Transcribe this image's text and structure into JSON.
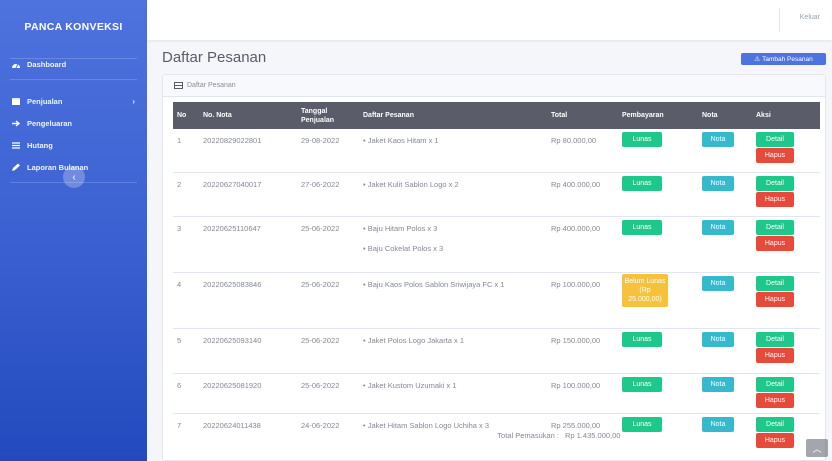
{
  "brand": "PANCA KONVEKSI",
  "sidebar": {
    "items": [
      {
        "label": "Dashboard",
        "icon": "dashboard-icon"
      },
      {
        "label": "Penjualan",
        "icon": "cart-icon"
      },
      {
        "label": "Pengeluaran",
        "icon": "arrow-right-icon"
      },
      {
        "label": "Hutang",
        "icon": "list-icon"
      },
      {
        "label": "Laporan Bulanan",
        "icon": "pencil-icon"
      }
    ]
  },
  "topbar": {
    "logout": "Keluar"
  },
  "page": {
    "title": "Daftar Pesanan",
    "add_button": "Tambah Pesanan",
    "card_title": "Daftar Pesanan"
  },
  "table": {
    "headers": [
      "No",
      "No. Nota",
      "Tanggal Penjualan",
      "Daftar Pesanan",
      "Total",
      "Pembayaran",
      "Nota",
      "Aksi"
    ],
    "rows": [
      {
        "no": "1",
        "nota": "20220829022801",
        "tanggal": "29-08-2022",
        "items": [
          "Jaket Kaos Hitam x 1"
        ],
        "total": "Rp 80.000,00",
        "bayar": "Lunas",
        "status": "lunas"
      },
      {
        "no": "2",
        "nota": "20220627040017",
        "tanggal": "27-06-2022",
        "items": [
          "Jaket Kulit Sablon Logo x 2"
        ],
        "total": "Rp 400.000,00",
        "bayar": "Lunas",
        "status": "lunas"
      },
      {
        "no": "3",
        "nota": "20220625110647",
        "tanggal": "25-06-2022",
        "items": [
          "Baju Hitam Polos x 3",
          "Baju Cokelat Polos x 3"
        ],
        "total": "Rp 400.000,00",
        "bayar": "Lunas",
        "status": "lunas"
      },
      {
        "no": "4",
        "nota": "20220625083846",
        "tanggal": "25-06-2022",
        "items": [
          "Baju Kaos Polos Sablon Sriwijaya FC x 1"
        ],
        "total": "Rp 100.000,00",
        "bayar": "Belum Lunas (Rp 25.000,00)",
        "status": "belum"
      },
      {
        "no": "5",
        "nota": "20220625093140",
        "tanggal": "25-06-2022",
        "items": [
          "Jaket Polos Logo Jakarta x 1"
        ],
        "total": "Rp 150.000,00",
        "bayar": "Lunas",
        "status": "lunas"
      },
      {
        "no": "6",
        "nota": "20220625081920",
        "tanggal": "25-06-2022",
        "items": [
          "Jaket Kustom Uzumaki x 1"
        ],
        "total": "Rp 100.000,00",
        "bayar": "Lunas",
        "status": "lunas"
      },
      {
        "no": "7",
        "nota": "20220624011438",
        "tanggal": "24-06-2022",
        "items": [
          "Jaket Hitam Sablon Logo Uchiha x 3"
        ],
        "total": "Rp 255.000,00",
        "bayar": "Lunas",
        "status": "lunas"
      }
    ],
    "nota_label": "Nota",
    "detail_label": "Detail",
    "hapus_label": "Hapus",
    "total_label": "Total Pemasukan :",
    "total_value": "Rp 1.435.000,00"
  },
  "colors": {
    "primary": "#4e73df",
    "success": "#1cc88a",
    "info": "#36b9cc",
    "warning": "#f6c23e",
    "danger": "#e74a3b",
    "header": "#5a5c69"
  }
}
